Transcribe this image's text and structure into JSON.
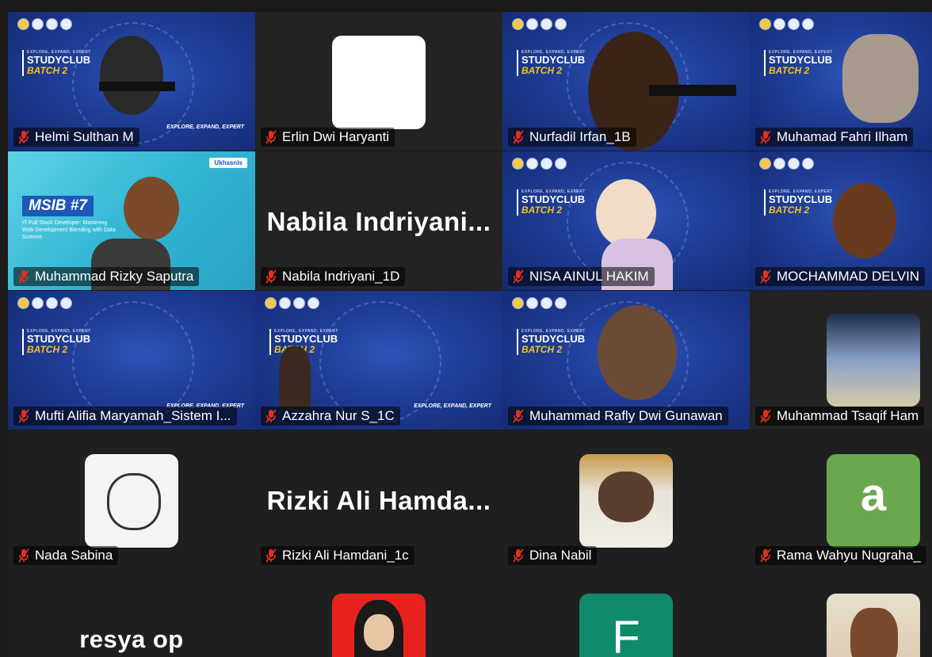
{
  "participants": [
    {
      "name": "Helmi Sulthan M",
      "muted": true,
      "video": "banner"
    },
    {
      "name": "Erlin Dwi Haryanti",
      "muted": true,
      "video": "white-avatar"
    },
    {
      "name": "Nurfadil Irfan_1B",
      "muted": true,
      "video": "banner"
    },
    {
      "name": "Muhamad Fahri Ilham",
      "muted": true,
      "video": "banner"
    },
    {
      "name": "Muhammad Rizky Saputra",
      "muted": true,
      "video": "msib"
    },
    {
      "name": "Nabila Indriyani_1D",
      "muted": true,
      "video": "name-only",
      "display_name": "Nabila  Indriyani..."
    },
    {
      "name": "NISA AINUL HAKIM",
      "muted": true,
      "video": "banner"
    },
    {
      "name": "MOCHAMMAD DELVIN",
      "muted": true,
      "video": "banner"
    },
    {
      "name": "Mufti Alifia Maryamah_Sistem I...",
      "muted": true,
      "video": "banner"
    },
    {
      "name": "Azzahra Nur S_1C",
      "muted": true,
      "video": "banner"
    },
    {
      "name": "Muhammad Rafly Dwi Gunawan",
      "muted": true,
      "video": "banner"
    },
    {
      "name": "Muhammad Tsaqif Ham",
      "muted": true,
      "video": "avatar"
    },
    {
      "name": "Nada Sabina",
      "muted": true,
      "video": "avatar"
    },
    {
      "name": "Rizki Ali Hamdani_1c",
      "muted": true,
      "video": "name-only",
      "display_name": "Rizki  Ali  Hamda..."
    },
    {
      "name": "Dina Nabil",
      "muted": true,
      "video": "avatar"
    },
    {
      "name": "Rama Wahyu Nugraha_",
      "muted": true,
      "video": "letter",
      "letter": "a"
    },
    {
      "name": "",
      "muted": false,
      "video": "name-only",
      "display_name": "resya op"
    },
    {
      "name": "",
      "muted": false,
      "video": "avatar"
    },
    {
      "name": "",
      "muted": false,
      "video": "letter",
      "letter": "F"
    },
    {
      "name": "",
      "muted": false,
      "video": "avatar"
    }
  ],
  "banner": {
    "tagline": "EXPLORE, EXPAND, EXPERT",
    "title": "STUDYCLUB",
    "batch": "BATCH 2"
  },
  "msib": {
    "title": "MSIB #7",
    "subtitle": "IT Full Stack Developer: Mastering Web Development Blending with Data Science",
    "partner": "Ukhasnis"
  },
  "colors": {
    "background": "#1a1a1a",
    "tile": "#232323",
    "banner_blue": "#1e3c94",
    "mute_red": "#e0301e",
    "letter_a_bg": "#6aa84f",
    "letter_f_bg": "#0f8a6a"
  }
}
